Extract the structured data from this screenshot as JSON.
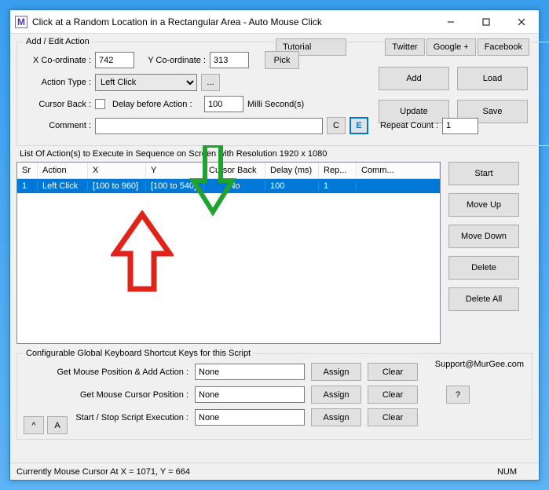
{
  "window": {
    "title": "Click at a Random Location in a Rectangular Area - Auto Mouse Click",
    "icon_letter": "M"
  },
  "links": {
    "twitter": "Twitter",
    "google": "Google +",
    "facebook": "Facebook",
    "tutorial": "Tutorial"
  },
  "edit": {
    "legend": "Add / Edit Action",
    "xcoord_lbl": "X Co-ordinate :",
    "xcoord_val": "742",
    "ycoord_lbl": "Y Co-ordinate :",
    "ycoord_val": "313",
    "pick": "Pick",
    "action_type_lbl": "Action Type :",
    "action_type_val": "Left Click",
    "more": "...",
    "cursor_back_lbl": "Cursor Back :",
    "delay_lbl": "Delay before Action :",
    "delay_val": "100",
    "ms_lbl": "Milli Second(s)",
    "comment_lbl": "Comment :",
    "c": "C",
    "e": "E",
    "repeat_lbl": "Repeat Count :",
    "repeat_val": "1"
  },
  "right": {
    "add": "Add",
    "load": "Load",
    "update": "Update",
    "save": "Save"
  },
  "list_label": "List Of Action(s) to Execute in Sequence on Screen with Resolution 1920 x 1080",
  "grid": {
    "headers": {
      "sr": "Sr",
      "action": "Action",
      "x": "X",
      "y": "Y",
      "cursor_back": "Cursor Back",
      "delay": "Delay (ms)",
      "rep": "Rep...",
      "comm": "Comm..."
    },
    "row": {
      "sr": "1",
      "action": "Left Click",
      "x": "[100 to 960]",
      "y": "[100 to 540]",
      "cursor_back": "No",
      "delay": "100",
      "rep": "1",
      "comm": ""
    }
  },
  "side": {
    "start": "Start",
    "moveup": "Move Up",
    "movedown": "Move Down",
    "delete": "Delete",
    "deleteall": "Delete All"
  },
  "cfg": {
    "legend": "Configurable Global Keyboard Shortcut Keys for this Script",
    "support": "Support@MurGee.com",
    "r1_lbl": "Get Mouse Position & Add Action :",
    "r2_lbl": "Get Mouse Cursor Position :",
    "r3_lbl": "Start / Stop Script Execution :",
    "none": "None",
    "assign": "Assign",
    "clear": "Clear",
    "help": "?",
    "a": "A",
    "caret": "^"
  },
  "status": {
    "left": "Currently Mouse Cursor At X = 1071, Y = 664",
    "right": "NUM"
  }
}
